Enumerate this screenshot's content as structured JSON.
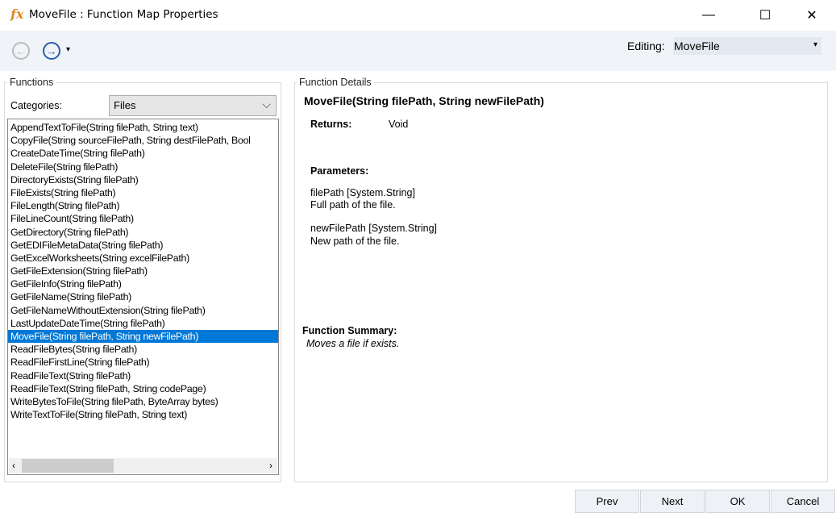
{
  "window": {
    "title": "MoveFile : Function Map Properties",
    "icon": "fx-icon",
    "minimize": "—",
    "maximize": "☐",
    "close": "✕"
  },
  "toolbar": {
    "back_icon": "←",
    "forward_icon": "→",
    "dropdown_icon": "▾",
    "editing_label": "Editing:",
    "editing_value": "MoveFile"
  },
  "functions": {
    "group_label": "Functions",
    "categories_label": "Categories:",
    "category_value": "Files",
    "items": [
      "AppendTextToFile(String filePath, String text)",
      "CopyFile(String sourceFilePath, String destFilePath, Bool",
      "CreateDateTime(String filePath)",
      "DeleteFile(String filePath)",
      "DirectoryExists(String filePath)",
      "FileExists(String filePath)",
      "FileLength(String filePath)",
      "FileLineCount(String filePath)",
      "GetDirectory(String filePath)",
      "GetEDIFileMetaData(String filePath)",
      "GetExcelWorksheets(String excelFilePath)",
      "GetFileExtension(String filePath)",
      "GetFileInfo(String filePath)",
      "GetFileName(String filePath)",
      "GetFileNameWithoutExtension(String filePath)",
      "LastUpdateDateTime(String filePath)",
      "MoveFile(String filePath, String newFilePath)",
      "ReadFileBytes(String filePath)",
      "ReadFileFirstLine(String filePath)",
      "ReadFileText(String filePath)",
      "ReadFileText(String filePath, String codePage)",
      "WriteBytesToFile(String filePath, ByteArray bytes)",
      "WriteTextToFile(String filePath, String text)"
    ],
    "selected_index": 16
  },
  "details": {
    "group_label": "Function Details",
    "signature": "MoveFile(String filePath, String newFilePath)",
    "returns_label": "Returns:",
    "returns_value": "Void",
    "parameters_label": "Parameters:",
    "params": [
      {
        "name": "filePath [System.String]",
        "desc": "Full path of the file."
      },
      {
        "name": "newFilePath [System.String]",
        "desc": "New path of the file."
      }
    ],
    "summary_label": "Function Summary:",
    "summary": "Moves a file if exists."
  },
  "buttons": {
    "prev": "Prev",
    "next": "Next",
    "ok": "OK",
    "cancel": "Cancel"
  }
}
